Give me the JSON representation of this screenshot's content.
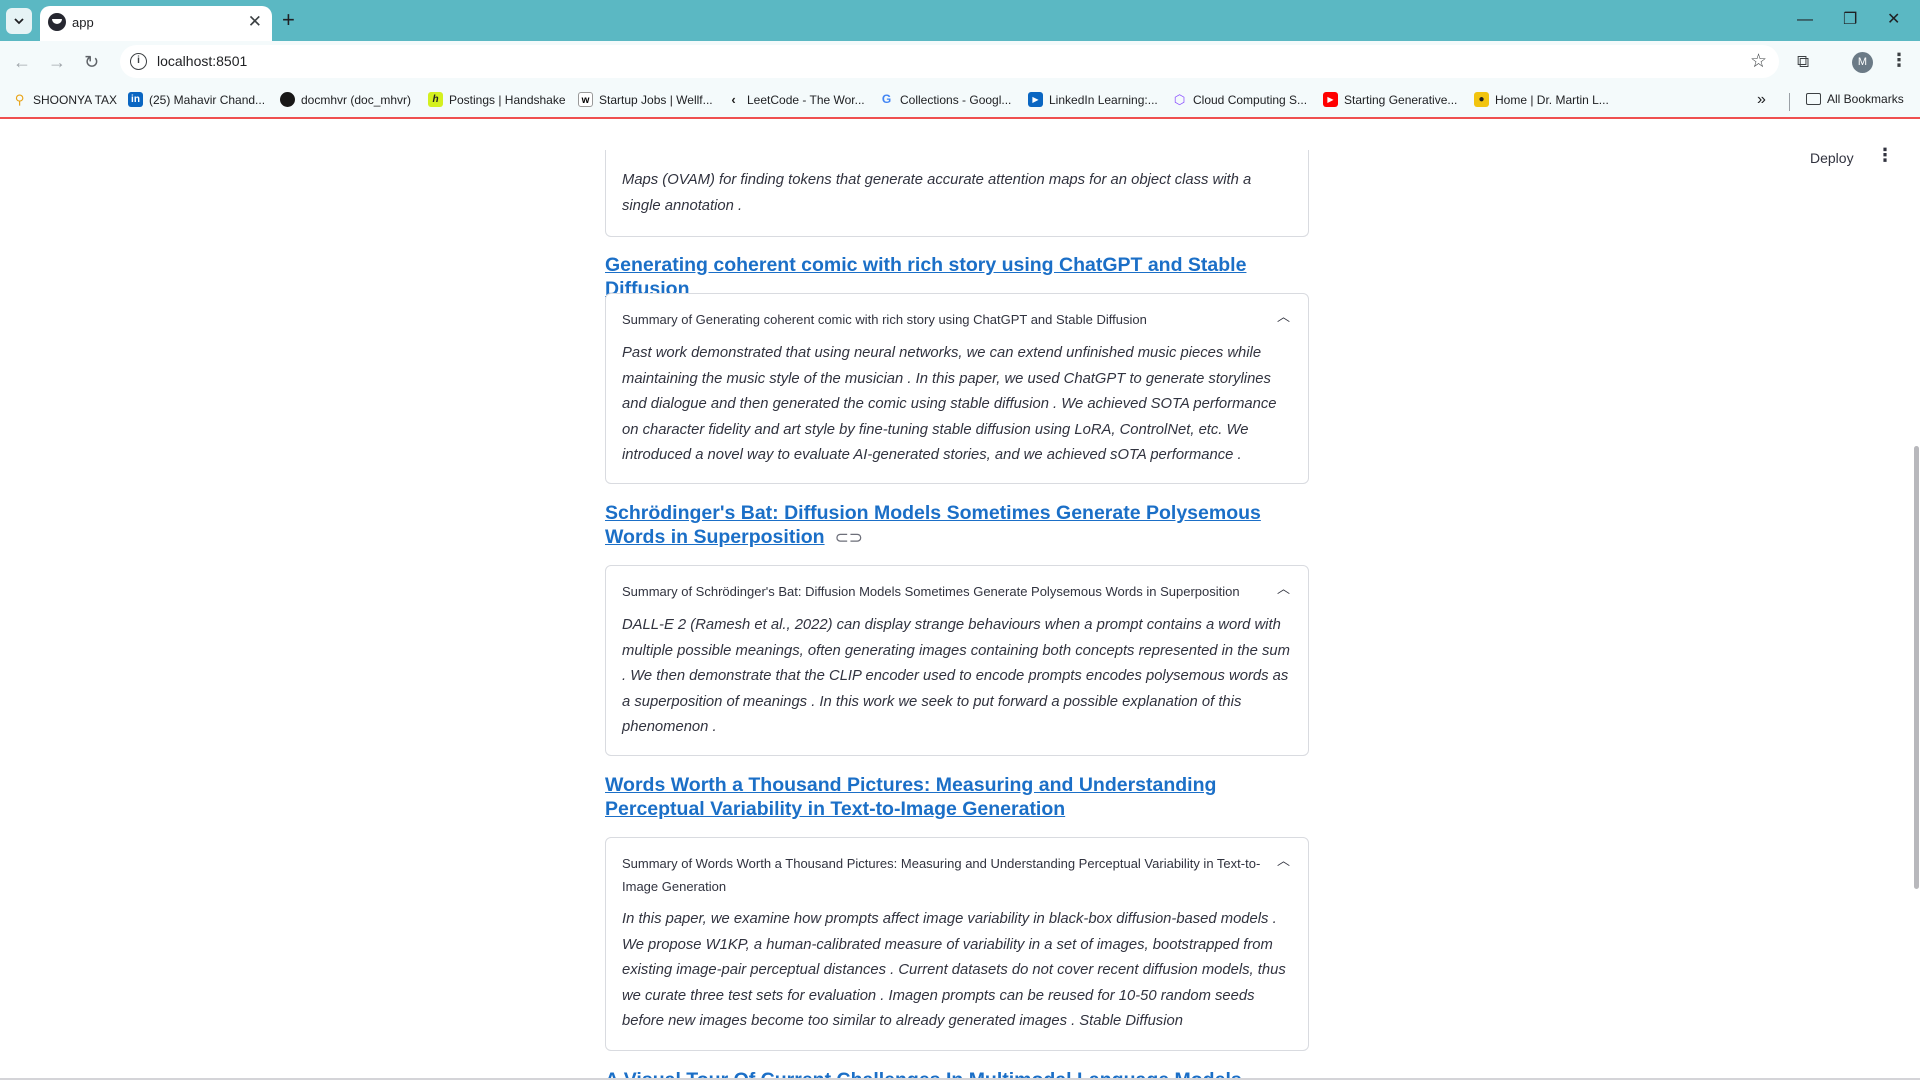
{
  "browser": {
    "tab_title": "app",
    "url": "localhost:8501",
    "profile_initial": "M",
    "bookmarks": [
      {
        "label": "SHOONYA TAX",
        "icon": "search-icon"
      },
      {
        "label": "(25) Mahavir Chand...",
        "icon": "linkedin-icon"
      },
      {
        "label": "docmhvr (doc_mhvr)",
        "icon": "github-icon"
      },
      {
        "label": "Postings | Handshake",
        "icon": "handshake-icon"
      },
      {
        "label": "Startup Jobs | Wellf...",
        "icon": "wellfound-icon"
      },
      {
        "label": "LeetCode - The Wor...",
        "icon": "leetcode-icon"
      },
      {
        "label": "Collections - Googl...",
        "icon": "google-icon"
      },
      {
        "label": "LinkedIn Learning:...",
        "icon": "linkedin-learning-icon"
      },
      {
        "label": "Cloud Computing S...",
        "icon": "cube-icon"
      },
      {
        "label": "Starting Generative...",
        "icon": "youtube-icon"
      },
      {
        "label": "Home | Dr. Martin L...",
        "icon": "bee-icon"
      }
    ],
    "all_bookmarks": "All Bookmarks"
  },
  "app": {
    "deploy_label": "Deploy"
  },
  "papers": [
    {
      "body": "Maps (OVAM) for finding tokens that generate accurate attention maps for an object class with a single annotation ."
    },
    {
      "title": "Generating coherent comic with rich story using ChatGPT and Stable Diffusion",
      "summary_header": "Summary of Generating coherent comic with rich story using ChatGPT and Stable Diffusion",
      "body": "Past work demonstrated that using neural networks, we can extend unfinished music pieces while maintaining the music style of the musician . In this paper, we used ChatGPT to generate storylines and dialogue and then generated the comic using stable diffusion . We achieved SOTA performance on character fidelity and art style by fine-tuning stable diffusion using LoRA, ControlNet, etc. We introduced a novel way to evaluate AI-generated stories, and we achieved sOTA performance ."
    },
    {
      "title": "Schrödinger's Bat: Diffusion Models Sometimes Generate Polysemous Words in Superposition",
      "summary_header": "Summary of Schrödinger's Bat: Diffusion Models Sometimes Generate Polysemous Words in Superposition",
      "body": "DALL-E 2 (Ramesh et al., 2022) can display strange behaviours when a prompt contains a word with multiple possible meanings, often generating images containing both concepts represented in the sum . We then demonstrate that the CLIP encoder used to encode prompts encodes polysemous words as a superposition of meanings . In this work we seek to put forward a possible explanation of this phenomenon ."
    },
    {
      "title": "Words Worth a Thousand Pictures: Measuring and Understanding Perceptual Variability in Text-to-Image Generation",
      "summary_header": "Summary of Words Worth a Thousand Pictures: Measuring and Understanding Perceptual Variability in Text-to-Image Generation",
      "body": "In this paper, we examine how prompts affect image variability in black-box diffusion-based models . We propose W1KP, a human-calibrated measure of variability in a set of images, bootstrapped from existing image-pair perceptual distances . Current datasets do not cover recent diffusion models, thus we curate three test sets for evaluation . Imagen prompts can be reused for 10-50 random seeds before new images become too similar to already generated images . Stable Diffusion"
    },
    {
      "title": "A Visual Tour Of Current Challenges In Multimodal Language Models"
    }
  ]
}
